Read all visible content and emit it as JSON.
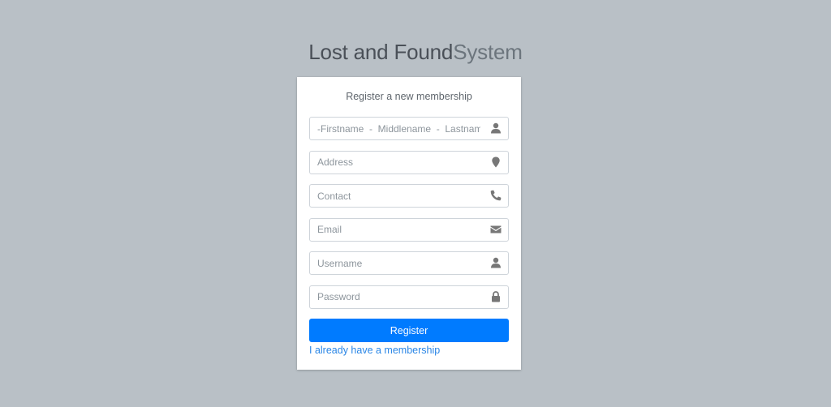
{
  "logo": {
    "bold": "Lost and Found",
    "light": "System"
  },
  "card": {
    "message": "Register a new membership"
  },
  "fields": {
    "fullname": {
      "placeholder": "-Firstname  -  Middlename  -  Lastname",
      "value": "",
      "icon": "user-icon"
    },
    "address": {
      "placeholder": "Address",
      "value": "",
      "icon": "map-marker-icon"
    },
    "contact": {
      "placeholder": "Contact",
      "value": "",
      "icon": "phone-icon"
    },
    "email": {
      "placeholder": "Email",
      "value": "",
      "icon": "envelope-icon"
    },
    "username": {
      "placeholder": "Username",
      "value": "",
      "icon": "user-icon"
    },
    "password": {
      "placeholder": "Password",
      "value": "",
      "icon": "lock-icon"
    }
  },
  "actions": {
    "register_label": "Register",
    "login_link": "I already have a membership"
  },
  "colors": {
    "background": "#b9c0c6",
    "primary": "#007bff",
    "link": "#2a86e6",
    "icon": "#777777"
  }
}
